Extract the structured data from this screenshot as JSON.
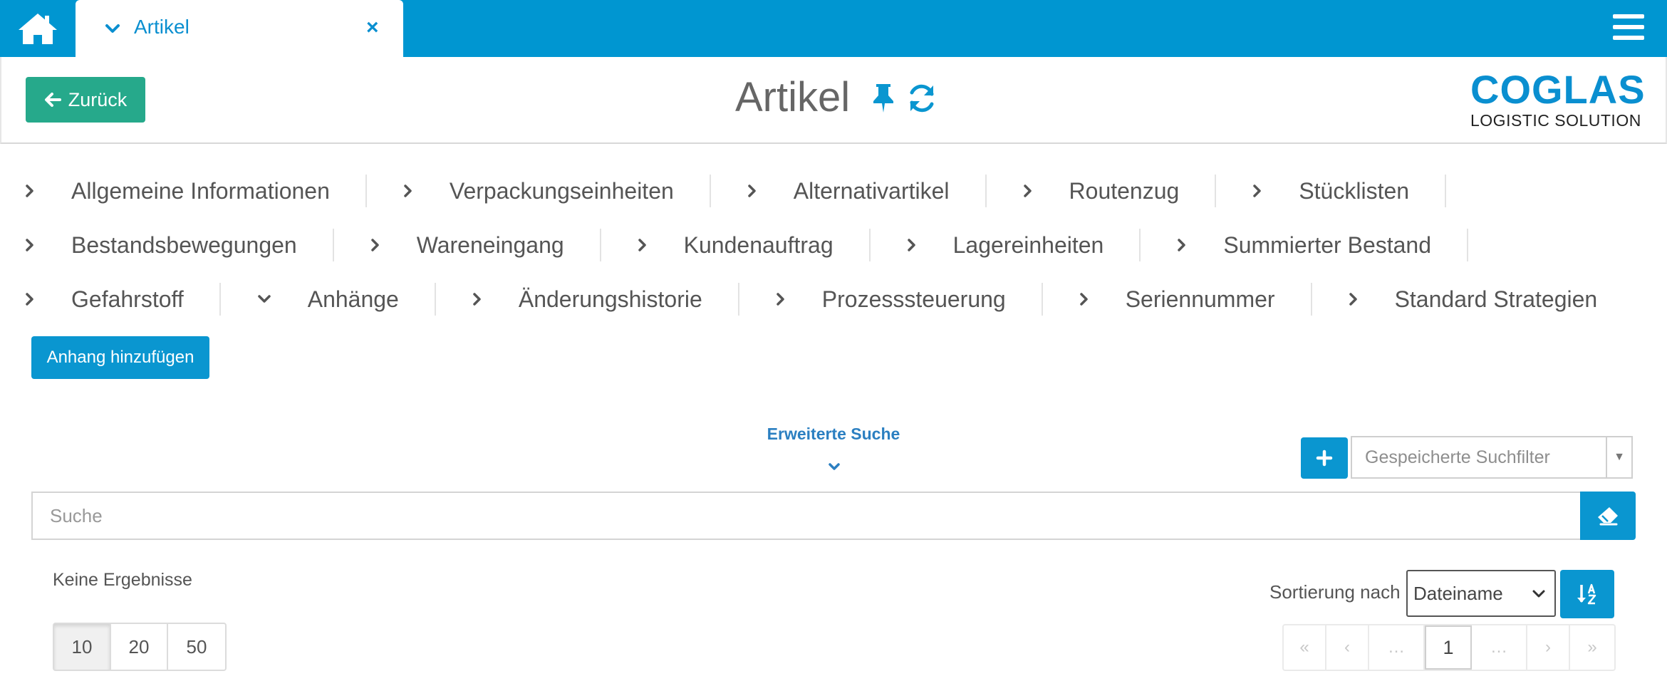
{
  "topbar": {
    "tab_label": "Artikel",
    "tab_close": "×",
    "accent_color": "#0096d1"
  },
  "header": {
    "back_label": "Zurück",
    "title": "Artikel",
    "logo_top": "COGLAS",
    "logo_bottom": "LOGISTIC SOLUTION"
  },
  "nav": {
    "rows": [
      [
        "Allgemeine Informationen",
        "Verpackungseinheiten",
        "Alternativartikel",
        "Routenzug",
        "Stücklisten"
      ],
      [
        "Bestandsbewegungen",
        "Wareneingang",
        "Kundenauftrag",
        "Lagereinheiten",
        "Summierter Bestand"
      ],
      [
        "Gefahrstoff",
        "Anhänge",
        "Änderungshistorie",
        "Prozesssteuerung",
        "Seriennummer",
        "Standard Strategien"
      ]
    ],
    "expanded_item": "Anhänge"
  },
  "attachments": {
    "add_label": "Anhang hinzufügen"
  },
  "search": {
    "extended_label": "Erweiterte Suche",
    "saved_filter_placeholder": "Gespeicherte Suchfilter",
    "placeholder": "Suche"
  },
  "results": {
    "status": "Keine Ergebnisse",
    "sort_label": "Sortierung nach",
    "sort_value": "Dateiname",
    "page_sizes": [
      "10",
      "20",
      "50"
    ],
    "active_page_size": "10"
  },
  "pagination": {
    "first": "«",
    "prev": "‹",
    "ellipsis_left": "…",
    "current": "1",
    "ellipsis_right": "…",
    "next": "›",
    "last": "»"
  }
}
